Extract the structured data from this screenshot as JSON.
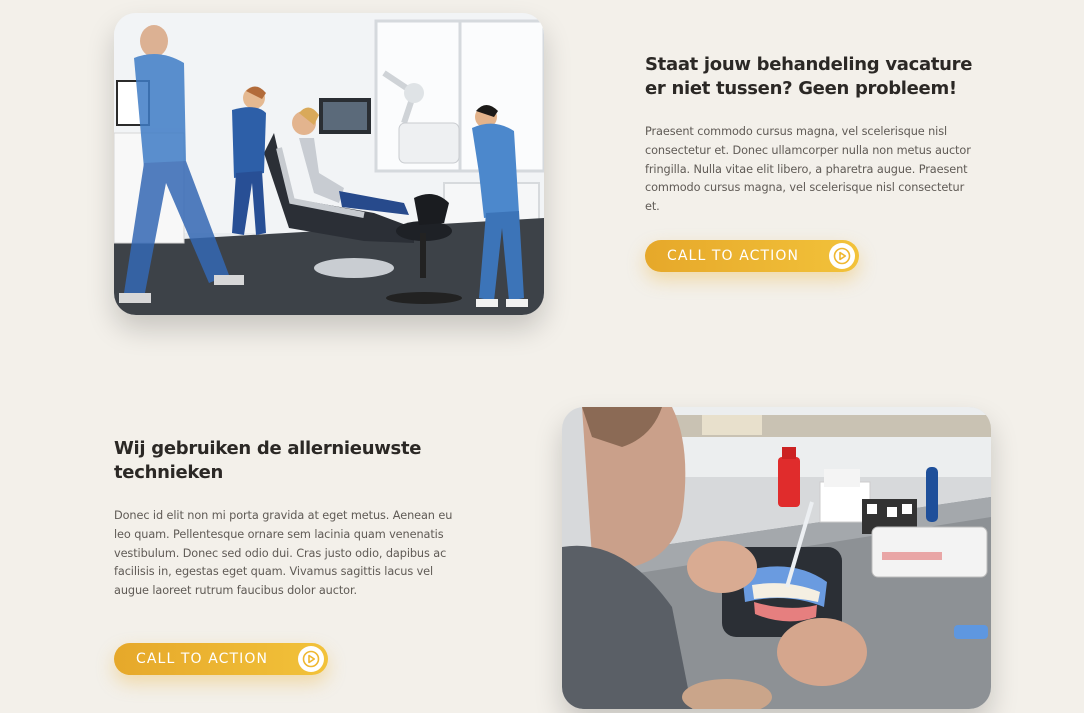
{
  "section_one": {
    "heading": "Staat jouw behandeling vacature er niet tussen? Geen probleem!",
    "body": "Praesent commodo cursus magna, vel scelerisque nisl consectetur et. Donec ullamcorper nulla non metus auctor fringilla. Nulla vitae elit libero, a pharetra augue. Praesent commodo cursus magna, vel scelerisque nisl consectetur et.",
    "cta_label": "CALL TO ACTION",
    "cta_icon": "play-icon"
  },
  "section_two": {
    "heading": "Wij gebruiken de allernieuwste technieken",
    "body": "Donec id elit non mi porta gravida at eget metus. Aenean eu leo quam. Pellentesque ornare sem lacinia quam venenatis vestibulum. Donec sed odio dui. Cras justo odio, dapibus ac facilisis in, egestas eget quam. Vivamus sagittis lacus vel augue laoreet rutrum faucibus dolor auctor.",
    "cta_label": "CALL TO ACTION",
    "cta_icon": "play-icon"
  },
  "colors": {
    "background": "#f3f0ea",
    "heading": "#2b2825",
    "body_text": "#5f5a55",
    "cta_gradient_start": "#e6a82a",
    "cta_gradient_end": "#f2c23a",
    "cta_text": "#ffffff"
  }
}
